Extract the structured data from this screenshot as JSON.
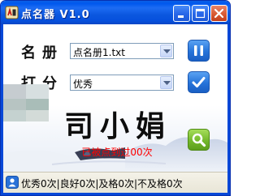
{
  "window": {
    "title": "点名器 V1.0"
  },
  "form": {
    "roster_label": "名册",
    "roster_value": "点名册1.txt",
    "grade_label": "打分",
    "grade_value": "优秀"
  },
  "display": {
    "student_name": "司小娟",
    "pick_count_text": "已被点到过00次"
  },
  "statusbar": {
    "summary": "优秀0次|良好0次|及格0次|不及格0次"
  },
  "icons": {
    "app": "roll-call-app-icon",
    "pause": "pause-icon",
    "confirm": "check-icon",
    "search": "magnifier-icon",
    "status": "user-icon"
  },
  "colors": {
    "titlebar": "#0058ee",
    "blue_button": "#2673d9",
    "green_button": "#74b82c",
    "count_text": "#ff0000"
  }
}
